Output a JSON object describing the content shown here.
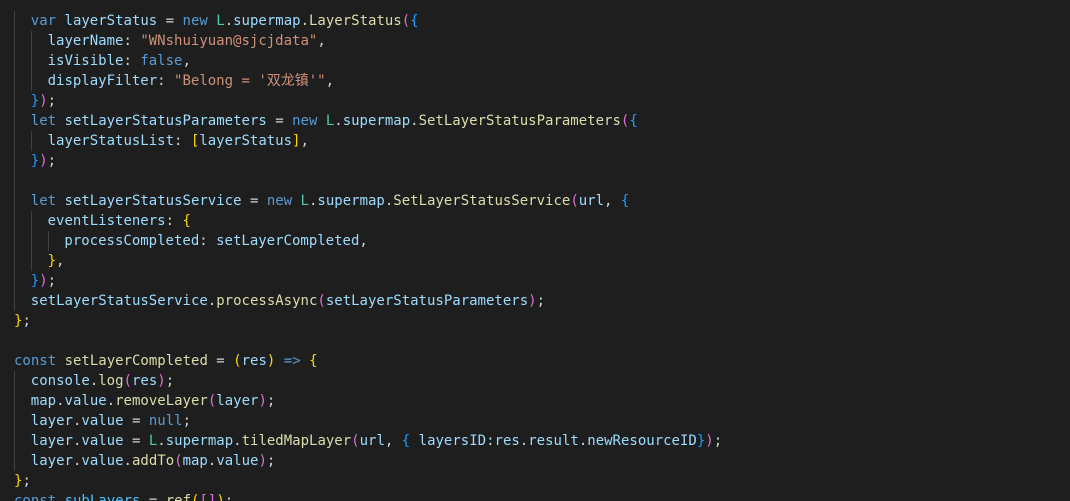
{
  "editor": {
    "language": "javascript",
    "theme_colors": {
      "background": "#1e1e1e",
      "keyword": "#569cd6",
      "variable": "#9cdcfe",
      "class": "#4ec9b0",
      "function": "#dcdcaa",
      "string": "#ce9178",
      "bracket_gold": "#ffd700",
      "bracket_purple": "#da70d6",
      "bracket_blue": "#179fff"
    },
    "lines": [
      {
        "indent": 1,
        "guides": [
          1
        ],
        "tokens": [
          [
            "kw",
            "var "
          ],
          [
            "var",
            "layerStatus"
          ],
          [
            "punc",
            " = "
          ],
          [
            "kw",
            "new "
          ],
          [
            "cls",
            "L"
          ],
          [
            "punc",
            "."
          ],
          [
            "var",
            "supermap"
          ],
          [
            "punc",
            "."
          ],
          [
            "fn",
            "LayerStatus"
          ],
          [
            "b2",
            "("
          ],
          [
            "b3",
            "{"
          ]
        ]
      },
      {
        "indent": 2,
        "guides": [
          1,
          2
        ],
        "tokens": [
          [
            "var",
            "layerName"
          ],
          [
            "punc",
            ": "
          ],
          [
            "str",
            "\"WNshuiyuan@sjcjdata\""
          ],
          [
            "punc",
            ","
          ]
        ]
      },
      {
        "indent": 2,
        "guides": [
          1,
          2
        ],
        "tokens": [
          [
            "var",
            "isVisible"
          ],
          [
            "punc",
            ": "
          ],
          [
            "kw",
            "false"
          ],
          [
            "punc",
            ","
          ]
        ]
      },
      {
        "indent": 2,
        "guides": [
          1,
          2
        ],
        "tokens": [
          [
            "var",
            "displayFilter"
          ],
          [
            "punc",
            ": "
          ],
          [
            "str",
            "\"Belong = '双龙镇'\""
          ],
          [
            "punc",
            ","
          ]
        ]
      },
      {
        "indent": 1,
        "guides": [
          1
        ],
        "tokens": [
          [
            "b3",
            "}"
          ],
          [
            "b2",
            ")"
          ],
          [
            "punc",
            ";"
          ]
        ]
      },
      {
        "indent": 1,
        "guides": [
          1
        ],
        "tokens": [
          [
            "kw",
            "let "
          ],
          [
            "var",
            "setLayerStatusParameters"
          ],
          [
            "punc",
            " = "
          ],
          [
            "kw",
            "new "
          ],
          [
            "cls",
            "L"
          ],
          [
            "punc",
            "."
          ],
          [
            "var",
            "supermap"
          ],
          [
            "punc",
            "."
          ],
          [
            "fn",
            "SetLayerStatusParameters"
          ],
          [
            "b2",
            "("
          ],
          [
            "b3",
            "{"
          ]
        ]
      },
      {
        "indent": 2,
        "guides": [
          1,
          2
        ],
        "tokens": [
          [
            "var",
            "layerStatusList"
          ],
          [
            "punc",
            ": "
          ],
          [
            "b1",
            "["
          ],
          [
            "var",
            "layerStatus"
          ],
          [
            "b1",
            "]"
          ],
          [
            "punc",
            ","
          ]
        ]
      },
      {
        "indent": 1,
        "guides": [
          1
        ],
        "tokens": [
          [
            "b3",
            "}"
          ],
          [
            "b2",
            ")"
          ],
          [
            "punc",
            ";"
          ]
        ]
      },
      {
        "indent": 0,
        "guides": [
          1
        ],
        "tokens": []
      },
      {
        "indent": 1,
        "guides": [
          1
        ],
        "tokens": [
          [
            "kw",
            "let "
          ],
          [
            "var",
            "setLayerStatusService"
          ],
          [
            "punc",
            " = "
          ],
          [
            "kw",
            "new "
          ],
          [
            "cls",
            "L"
          ],
          [
            "punc",
            "."
          ],
          [
            "var",
            "supermap"
          ],
          [
            "punc",
            "."
          ],
          [
            "fn",
            "SetLayerStatusService"
          ],
          [
            "b2",
            "("
          ],
          [
            "var",
            "url"
          ],
          [
            "punc",
            ", "
          ],
          [
            "b3",
            "{"
          ]
        ]
      },
      {
        "indent": 2,
        "guides": [
          1,
          2
        ],
        "tokens": [
          [
            "var",
            "eventListeners"
          ],
          [
            "punc",
            ": "
          ],
          [
            "b1",
            "{"
          ]
        ]
      },
      {
        "indent": 3,
        "guides": [
          1,
          2,
          3
        ],
        "tokens": [
          [
            "var",
            "processCompleted"
          ],
          [
            "punc",
            ": "
          ],
          [
            "var",
            "setLayerCompleted"
          ],
          [
            "punc",
            ","
          ]
        ]
      },
      {
        "indent": 2,
        "guides": [
          1,
          2
        ],
        "tokens": [
          [
            "b1",
            "}"
          ],
          [
            "punc",
            ","
          ]
        ]
      },
      {
        "indent": 1,
        "guides": [
          1
        ],
        "tokens": [
          [
            "b3",
            "}"
          ],
          [
            "b2",
            ")"
          ],
          [
            "punc",
            ";"
          ]
        ]
      },
      {
        "indent": 1,
        "guides": [
          1
        ],
        "tokens": [
          [
            "var",
            "setLayerStatusService"
          ],
          [
            "punc",
            "."
          ],
          [
            "fn",
            "processAsync"
          ],
          [
            "b2",
            "("
          ],
          [
            "var",
            "setLayerStatusParameters"
          ],
          [
            "b2",
            ")"
          ],
          [
            "punc",
            ";"
          ]
        ]
      },
      {
        "indent": 0,
        "guides": [],
        "tokens": [
          [
            "b1",
            "}"
          ],
          [
            "punc",
            ";"
          ]
        ]
      },
      {
        "indent": 0,
        "guides": [],
        "tokens": []
      },
      {
        "indent": 0,
        "guides": [],
        "tokens": [
          [
            "kw",
            "const "
          ],
          [
            "fn",
            "setLayerCompleted"
          ],
          [
            "punc",
            " = "
          ],
          [
            "b1",
            "("
          ],
          [
            "var",
            "res"
          ],
          [
            "b1",
            ")"
          ],
          [
            "punc",
            " "
          ],
          [
            "kw",
            "=>"
          ],
          [
            "punc",
            " "
          ],
          [
            "b1",
            "{"
          ]
        ]
      },
      {
        "indent": 1,
        "guides": [
          1
        ],
        "tokens": [
          [
            "var",
            "console"
          ],
          [
            "punc",
            "."
          ],
          [
            "fn",
            "log"
          ],
          [
            "b2",
            "("
          ],
          [
            "var",
            "res"
          ],
          [
            "b2",
            ")"
          ],
          [
            "punc",
            ";"
          ]
        ]
      },
      {
        "indent": 1,
        "guides": [
          1
        ],
        "tokens": [
          [
            "var",
            "map"
          ],
          [
            "punc",
            "."
          ],
          [
            "var",
            "value"
          ],
          [
            "punc",
            "."
          ],
          [
            "fn",
            "removeLayer"
          ],
          [
            "b2",
            "("
          ],
          [
            "var",
            "layer"
          ],
          [
            "b2",
            ")"
          ],
          [
            "punc",
            ";"
          ]
        ]
      },
      {
        "indent": 1,
        "guides": [
          1
        ],
        "tokens": [
          [
            "var",
            "layer"
          ],
          [
            "punc",
            "."
          ],
          [
            "var",
            "value"
          ],
          [
            "punc",
            " = "
          ],
          [
            "kw",
            "null"
          ],
          [
            "punc",
            ";"
          ]
        ]
      },
      {
        "indent": 1,
        "guides": [
          1
        ],
        "tokens": [
          [
            "var",
            "layer"
          ],
          [
            "punc",
            "."
          ],
          [
            "var",
            "value"
          ],
          [
            "punc",
            " = "
          ],
          [
            "cls",
            "L"
          ],
          [
            "punc",
            "."
          ],
          [
            "var",
            "supermap"
          ],
          [
            "punc",
            "."
          ],
          [
            "fn",
            "tiledMapLayer"
          ],
          [
            "b2",
            "("
          ],
          [
            "var",
            "url"
          ],
          [
            "punc",
            ", "
          ],
          [
            "b3",
            "{"
          ],
          [
            "punc",
            " "
          ],
          [
            "var",
            "layersID"
          ],
          [
            "punc",
            ":"
          ],
          [
            "var",
            "res"
          ],
          [
            "punc",
            "."
          ],
          [
            "var",
            "result"
          ],
          [
            "punc",
            "."
          ],
          [
            "var",
            "newResourceID"
          ],
          [
            "b3",
            "}"
          ],
          [
            "b2",
            ")"
          ],
          [
            "punc",
            ";"
          ]
        ]
      },
      {
        "indent": 1,
        "guides": [
          1
        ],
        "tokens": [
          [
            "var",
            "layer"
          ],
          [
            "punc",
            "."
          ],
          [
            "var",
            "value"
          ],
          [
            "punc",
            "."
          ],
          [
            "fn",
            "addTo"
          ],
          [
            "b2",
            "("
          ],
          [
            "var",
            "map"
          ],
          [
            "punc",
            "."
          ],
          [
            "var",
            "value"
          ],
          [
            "b2",
            ")"
          ],
          [
            "punc",
            ";"
          ]
        ]
      },
      {
        "indent": 0,
        "guides": [],
        "tokens": [
          [
            "b1",
            "}"
          ],
          [
            "punc",
            ";"
          ]
        ]
      },
      {
        "indent": 0,
        "guides": [],
        "tokens": [
          [
            "kw",
            "const "
          ],
          [
            "const",
            "subLayers"
          ],
          [
            "punc",
            " = "
          ],
          [
            "fn",
            "ref"
          ],
          [
            "b1",
            "("
          ],
          [
            "b2",
            "["
          ],
          [
            "b2",
            "]"
          ],
          [
            "b1",
            ")"
          ],
          [
            "punc",
            ";"
          ]
        ]
      }
    ]
  }
}
